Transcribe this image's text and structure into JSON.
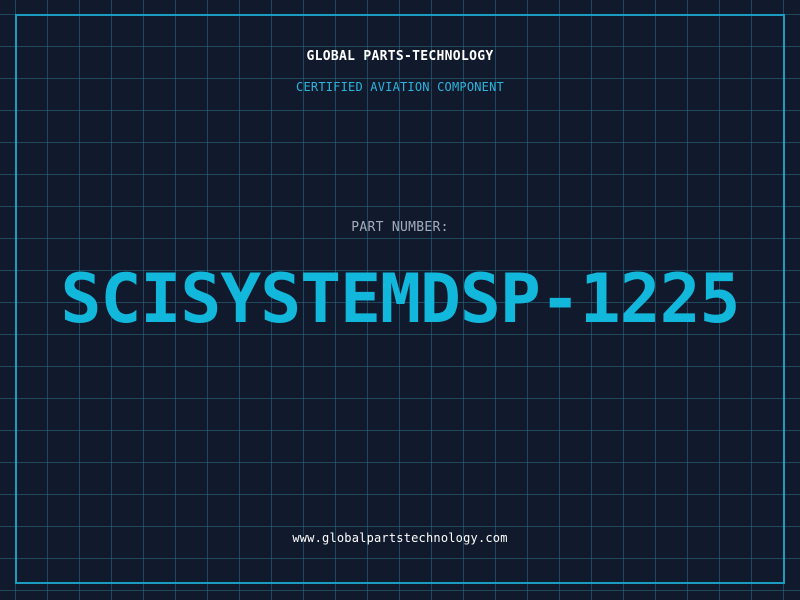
{
  "header": {
    "company": "GLOBAL PARTS-TECHNOLOGY",
    "tagline": "CERTIFIED AVIATION COMPONENT"
  },
  "part": {
    "label": "PART NUMBER:",
    "number": "SCISYSTEMDSP-1225"
  },
  "footer": {
    "website": "www.globalpartstechnology.com"
  },
  "colors": {
    "background": "#111a2c",
    "grid": "#286e87",
    "accent": "#12b7dc",
    "frame": "#1a9cc0"
  }
}
